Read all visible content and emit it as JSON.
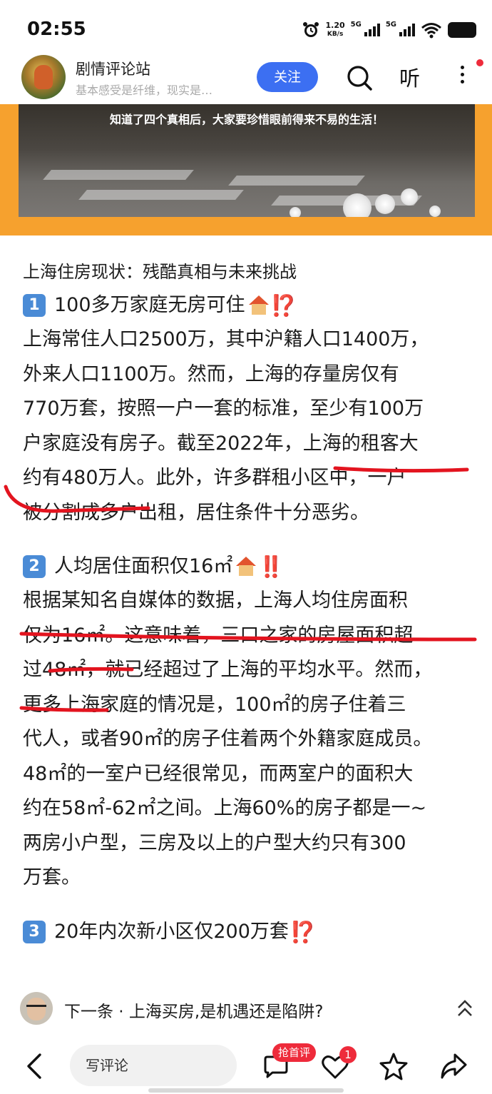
{
  "status_bar": {
    "time": "02:55",
    "net_speed_value": "1.20",
    "net_speed_unit": "KB/s",
    "signal_1": "5G",
    "signal_2": "5G",
    "icons": [
      "alarm-icon",
      "signal-icon",
      "signal-icon",
      "wifi-icon",
      "battery-icon"
    ]
  },
  "header": {
    "account_name": "剧情评论站",
    "account_desc": "基本感受是纤维，现实是…",
    "follow_label": "关注",
    "listen_label": "听",
    "icons": [
      "search-icon",
      "more-icon"
    ]
  },
  "banner": {
    "caption": "知道了四个真相后，大家要珍惜眼前得来不易的生活！"
  },
  "article": {
    "title": "上海住房现状：残酷真相与未来挑战",
    "sections": [
      {
        "number": "1",
        "heading": "100多万家庭无房可住",
        "suffix": "⁉️",
        "lines": [
          "上海常住人口2500万，其中沪籍人口1400万，",
          "外来人口1100万。然而，上海的存量房仅有",
          "770万套，按照一户一套的标准，至少有100万",
          "户家庭没有房子。截至2022年，上海的租客大",
          "约有480万人。此外，许多群租小区中，一户",
          "被分割成多户出租，居住条件十分恶劣。"
        ]
      },
      {
        "number": "2",
        "heading": "人均居住面积仅16㎡",
        "suffix": "‼️",
        "lines": [
          "根据某知名自媒体的数据，上海人均住房面积",
          "仅为16㎡。这意味着，三口之家的房屋面积超",
          "过48㎡，就已经超过了上海的平均水平。然而，",
          "更多上海家庭的情况是，100㎡的房子住着三",
          "代人，或者90㎡的房子住着两个外籍家庭成员。",
          "48㎡的一室户已经很常见，而两室户的面积大",
          "约在58㎡-62㎡之间。上海60%的房子都是一~",
          "两房小户型，三房及以上的户型大约只有300",
          "万套。"
        ]
      },
      {
        "number": "3",
        "heading": "20年内次新小区仅200万套",
        "suffix": "⁉️"
      }
    ]
  },
  "next_bar": {
    "text": "下一条 · 上海买房,是机遇还是陷阱?"
  },
  "bottom_bar": {
    "comment_placeholder": "写评论",
    "first_comment_badge": "抢首评",
    "like_count": "1"
  },
  "colors": {
    "accent_blue": "#3c6ff2",
    "banner_orange": "#f6a12e",
    "annotation_red": "#e3141f",
    "badge_red": "#ee2b3b"
  }
}
